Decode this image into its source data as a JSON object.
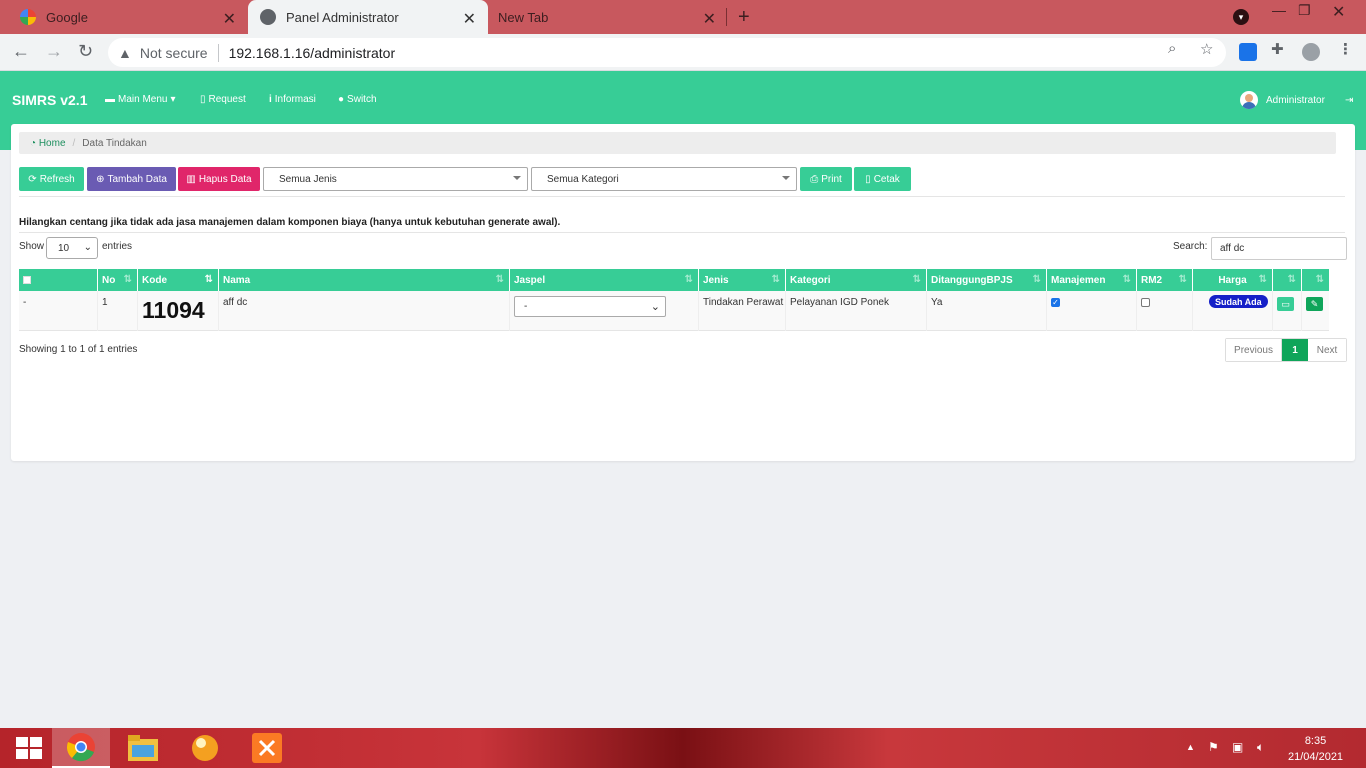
{
  "browser": {
    "tabs": [
      {
        "title": "Google"
      },
      {
        "title": "Panel Administrator"
      },
      {
        "title": "New Tab"
      }
    ],
    "security_label": "Not secure",
    "url": "192.168.1.16/administrator"
  },
  "header": {
    "brand": "SIMRS v2.1",
    "nav": [
      {
        "label": "Main Menu",
        "icon": "folder-icon"
      },
      {
        "label": "Request",
        "icon": "file-icon"
      },
      {
        "label": "Informasi",
        "icon": "info-icon"
      },
      {
        "label": "Switch",
        "icon": "users-icon"
      }
    ],
    "user": "Administrator"
  },
  "breadcrumb": {
    "home": "Home",
    "current": "Data Tindakan"
  },
  "toolbar": {
    "refresh": "Refresh",
    "add": "Tambah Data",
    "delete": "Hapus Data",
    "jenis_select": "Semua Jenis",
    "kategori_select": "Semua Kategori",
    "print": "Print",
    "cetak": "Cetak"
  },
  "note": "Hilangkan centang jika tidak ada jasa manajemen dalam komponen biaya (hanya untuk kebutuhan generate awal).",
  "table_controls": {
    "show_label": "Show",
    "page_length": "10",
    "entries_label": "entries",
    "search_label": "Search:",
    "search_value": "aff dc"
  },
  "table": {
    "columns": [
      "No",
      "Kode",
      "Nama",
      "Jaspel",
      "Jenis",
      "Kategori",
      "DitanggungBPJS",
      "Manajemen",
      "RM2",
      "Harga"
    ],
    "rows": [
      {
        "select": "-",
        "no": "1",
        "kode": "11094",
        "nama": "aff dc",
        "jaspel": "-",
        "jenis": "Tindakan Perawat",
        "kategori": "Pelayanan IGD Ponek",
        "bpjs": "Ya",
        "manajemen_checked": true,
        "rm2_checked": false,
        "harga": "Sudah Ada"
      }
    ]
  },
  "footer": {
    "info": "Showing 1 to 1 of 1 entries",
    "prev": "Previous",
    "page": "1",
    "next": "Next"
  },
  "taskbar": {
    "time": "8:35",
    "date": "21/04/2021"
  },
  "colors": {
    "brand_green": "#37cd96",
    "purple": "#6a5bb3",
    "red": "#e0266a",
    "badge_blue": "#1520c8",
    "page_active": "#0fa55a",
    "tab_bar": "#c8585e"
  }
}
